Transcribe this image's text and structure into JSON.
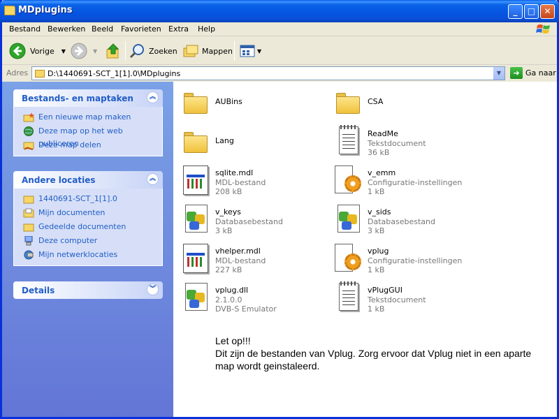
{
  "window": {
    "title": "MDplugins"
  },
  "menu": [
    "Bestand",
    "Bewerken",
    "Beeld",
    "Favorieten",
    "Extra",
    "Help"
  ],
  "toolbar": {
    "back": "Vorige",
    "search": "Zoeken",
    "folders": "Mappen"
  },
  "address": {
    "label": "Adres",
    "path": "D:\\1440691-SCT_1[1].0\\MDplugins",
    "go": "Ga naar"
  },
  "panels": {
    "tasks": {
      "title": "Bestands- en maptaken",
      "items": [
        "Een nieuwe map maken",
        "Deze map op het web publiceren",
        "Deze map delen"
      ]
    },
    "other": {
      "title": "Andere locaties",
      "items": [
        "1440691-SCT_1[1].0",
        "Mijn documenten",
        "Gedeelde documenten",
        "Deze computer",
        "Mijn netwerklocaties"
      ]
    },
    "details": {
      "title": "Details"
    }
  },
  "files": [
    {
      "name": "AUBins",
      "kind": "folder"
    },
    {
      "name": "CSA",
      "kind": "folder"
    },
    {
      "name": "Lang",
      "kind": "folder"
    },
    {
      "name": "ReadMe",
      "type": "Tekstdocument",
      "size": "36 kB",
      "kind": "text"
    },
    {
      "name": "sqlite.mdl",
      "type": "MDL-bestand",
      "size": "208 kB",
      "kind": "mdl"
    },
    {
      "name": "v_emm",
      "type": "Configuratie-instellingen",
      "size": "1 kB",
      "kind": "config"
    },
    {
      "name": "v_keys",
      "type": "Databasebestand",
      "size": "3 kB",
      "kind": "db"
    },
    {
      "name": "v_sids",
      "type": "Databasebestand",
      "size": "3 kB",
      "kind": "db"
    },
    {
      "name": "vhelper.mdl",
      "type": "MDL-bestand",
      "size": "227 kB",
      "kind": "mdl"
    },
    {
      "name": "vplug",
      "type": "Configuratie-instellingen",
      "size": "1 kB",
      "kind": "config"
    },
    {
      "name": "vplug.dll",
      "type": "2.1.0.0",
      "size": "DVB-S Emulator",
      "kind": "dll"
    },
    {
      "name": "vPlugGUI",
      "type": "Tekstdocument",
      "size": "1 kB",
      "kind": "text"
    }
  ],
  "note": {
    "line1": "Let op!!!",
    "line2": "Dit zijn de bestanden van Vplug. Zorg ervoor dat Vplug niet in een aparte map wordt geinstaleerd."
  },
  "colors": {
    "titlebar": "#0454e0",
    "task_link": "#215dc6",
    "task_bg": "#6f8fe0"
  }
}
